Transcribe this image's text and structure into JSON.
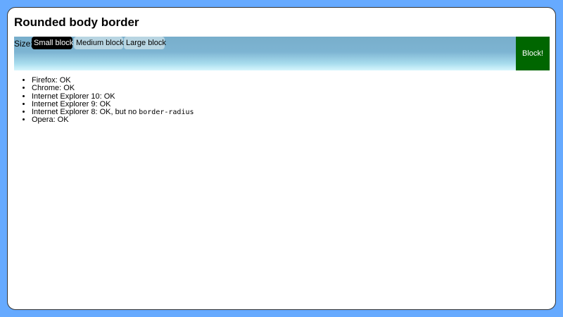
{
  "page": {
    "title": "Rounded body border"
  },
  "toolbar": {
    "size_label": "Size:",
    "sizes": [
      {
        "label": "Small block",
        "selected": true
      },
      {
        "label": "Medium block",
        "selected": false
      },
      {
        "label": "Large block",
        "selected": false
      }
    ],
    "action_label": "Block!"
  },
  "results": [
    {
      "text": "Firefox: OK"
    },
    {
      "text": "Chrome: OK"
    },
    {
      "text": "Internet Explorer 10: OK"
    },
    {
      "text": "Internet Explorer 9: OK"
    },
    {
      "text": "Internet Explorer 8: OK, but no ",
      "code": "border-radius"
    },
    {
      "text": "Opera: OK"
    }
  ],
  "colors": {
    "page_background": "#66aaff",
    "selected_button": "#000000",
    "unselected_button": "#b8d5e2",
    "block_button": "#006600",
    "toolbar_top": "#78aecb",
    "toolbar_bottom": "#d6f6fd"
  }
}
